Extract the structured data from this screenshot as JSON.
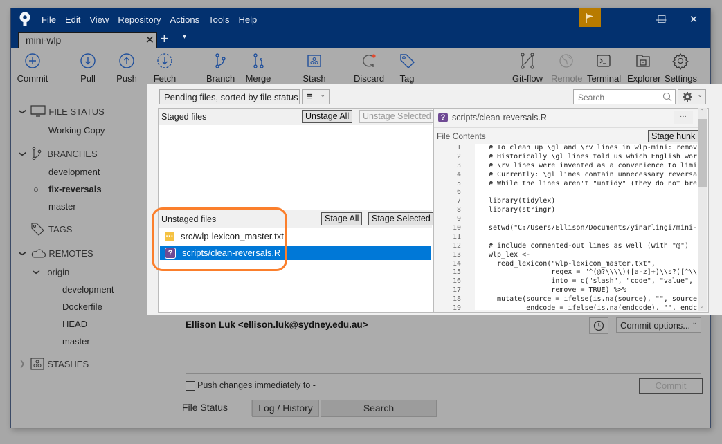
{
  "window": {
    "menu": [
      "File",
      "Edit",
      "View",
      "Repository",
      "Actions",
      "Tools",
      "Help"
    ],
    "controls": {
      "minimize": "—",
      "maximize": "☐",
      "close": "✕"
    }
  },
  "tabs": {
    "repo_tab": "mini-wlp",
    "close_symbol": "✕",
    "add_symbol": "+",
    "dropdown_symbol": "▾"
  },
  "toolbar": {
    "items": [
      {
        "label": "Commit",
        "icon": "commit-icon"
      },
      {
        "label": "Pull",
        "icon": "pull-icon"
      },
      {
        "label": "Push",
        "icon": "push-icon"
      },
      {
        "label": "Fetch",
        "icon": "fetch-icon"
      },
      {
        "label": "Branch",
        "icon": "branch-icon"
      },
      {
        "label": "Merge",
        "icon": "merge-icon"
      },
      {
        "label": "Stash",
        "icon": "stash-icon"
      },
      {
        "label": "Discard",
        "icon": "discard-icon"
      },
      {
        "label": "Tag",
        "icon": "tag-icon"
      },
      {
        "label": "Git-flow",
        "icon": "git-flow-icon"
      },
      {
        "label": "Remote",
        "icon": "remote-icon",
        "disabled": true
      },
      {
        "label": "Terminal",
        "icon": "terminal-icon"
      },
      {
        "label": "Explorer",
        "icon": "explorer-icon"
      },
      {
        "label": "Settings",
        "icon": "settings-icon"
      }
    ]
  },
  "sidebar": {
    "file_status": {
      "header": "FILE STATUS",
      "items": [
        "Working Copy"
      ]
    },
    "branches": {
      "header": "BRANCHES",
      "items": [
        "development",
        "fix-reversals",
        "master"
      ],
      "current": "fix-reversals"
    },
    "tags": {
      "header": "TAGS"
    },
    "remotes": {
      "header": "REMOTES",
      "origin": {
        "name": "origin",
        "items": [
          "development",
          "Dockerfile",
          "HEAD",
          "master"
        ]
      }
    },
    "stashes": {
      "header": "STASHES"
    }
  },
  "file_panel": {
    "sort_dropdown": "Pending files, sorted by file status",
    "view_dropdown_icon": "≡",
    "staged": {
      "label": "Staged files",
      "unstage_all": "Unstage All",
      "unstage_selected": "Unstage Selected",
      "files": []
    },
    "unstaged": {
      "label": "Unstaged files",
      "stage_all": "Stage All",
      "stage_selected": "Stage Selected",
      "files": [
        {
          "name": "src/wlp-lexicon_master.txt",
          "status": "modified",
          "icon_text": "···",
          "color": "#f5c242"
        },
        {
          "name": "scripts/clean-reversals.R",
          "status": "untracked",
          "icon_text": "?",
          "color": "#6f4a94",
          "selected": true
        }
      ]
    }
  },
  "search": {
    "placeholder": "Search"
  },
  "diff": {
    "file_name": "scripts/clean-reversals.R",
    "more_button": "···",
    "section_label": "File Contents",
    "stage_hunk": "Stage hunk",
    "lines": [
      {
        "n": "1",
        "text": "# To clean up \\gl and \\rv lines in wlp-mini: remov"
      },
      {
        "n": "2",
        "text": "# Historically \\gl lines told us which English wor"
      },
      {
        "n": "3",
        "text": "# \\rv lines were invented as a convenience to limi"
      },
      {
        "n": "4",
        "text": "# Currently: \\gl lines contain unnecessary reversa"
      },
      {
        "n": "5",
        "text": "# While the lines aren't \"untidy\" (they do not bre"
      },
      {
        "n": "6",
        "text": ""
      },
      {
        "n": "7",
        "text": "library(tidylex)"
      },
      {
        "n": "8",
        "text": "library(stringr)"
      },
      {
        "n": "9",
        "text": ""
      },
      {
        "n": "10",
        "text": "setwd(\"C:/Users/Ellison/Documents/yinarlingi/mini-"
      },
      {
        "n": "11",
        "text": ""
      },
      {
        "n": "12",
        "text": "# include commented-out lines as well (with \"@\")"
      },
      {
        "n": "13",
        "text": "wlp_lex <-"
      },
      {
        "n": "14",
        "text": "  read_lexicon(\"wlp-lexicon_master.txt\","
      },
      {
        "n": "15",
        "text": "               regex = \"^(@?\\\\\\\\)([a-z]+)\\\\s?([^\\\\"
      },
      {
        "n": "16",
        "text": "               into = c(\"slash\", \"code\", \"value\","
      },
      {
        "n": "17",
        "text": "               remove = TRUE) %>%"
      },
      {
        "n": "18",
        "text": "  mutate(source = ifelse(is.na(source), \"\", source"
      },
      {
        "n": "19",
        "text": "         endcode = ifelse(is.na(endcode), \"\", endc"
      }
    ]
  },
  "commit": {
    "author": "Ellison Luk <ellison.luk@sydney.edu.au>",
    "options": "Commit options...",
    "message": "",
    "push_label": "Push changes immediately to -",
    "push_checked": false,
    "commit_button": "Commit"
  },
  "bottom_tabs": [
    {
      "label": "File Status",
      "active": true
    },
    {
      "label": "Log / History",
      "active": false
    },
    {
      "label": "Search",
      "active": false
    }
  ],
  "colors": {
    "titlebar": "#03316f",
    "accent_selected": "#0078d7",
    "highlight_ring": "#fb7f2c",
    "flag": "#b87b00",
    "icon_blue": "#1f4f9c"
  }
}
